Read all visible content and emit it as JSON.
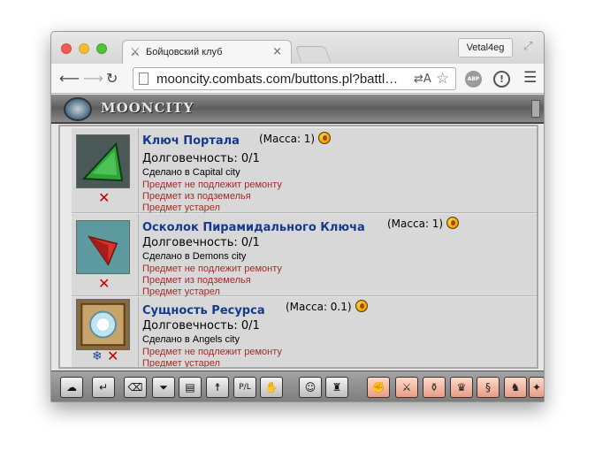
{
  "browser": {
    "tab_title": "Бойцовский клуб",
    "tab_close": "×",
    "profile_name": "Vetal4eg",
    "url": "mooncity.combats.com/buttons.pl?battl…",
    "translate_glyph": "⇄A",
    "abp_label": "ABP",
    "ext_label": "!"
  },
  "banner": {
    "title": "MOONCITY"
  },
  "items": [
    {
      "name": "Ключ Портала",
      "weight": "(Масса: 1)",
      "durability": "Долговечность: 0/1",
      "made_in": "Сделано в Capital city",
      "notes": [
        "Предмет не подлежит ремонту",
        "Предмет из подземелья",
        "Предмет устарел"
      ]
    },
    {
      "name": "Осколок Пирамидального Ключа",
      "weight": "(Масса: 1)",
      "durability": "Долговечность: 0/1",
      "made_in": "Сделано в Demons city",
      "notes": [
        "Предмет не подлежит ремонту",
        "Предмет из подземелья",
        "Предмет устарел"
      ]
    },
    {
      "name": "Сущность Ресурса",
      "weight": "(Масса: 0.1)",
      "durability": "Долговечность: 0/1",
      "made_in": "Сделано в Angels city",
      "notes": [
        "Предмет не подлежит ремонту",
        "Предмет устарел"
      ]
    }
  ],
  "icons": {
    "remove": "✕",
    "snowflake": "❄"
  },
  "bottom_bar": [
    {
      "name": "chat-icon",
      "glyph": "☁",
      "style": "grey"
    },
    {
      "name": "enter-icon",
      "glyph": "↵",
      "style": "grey"
    },
    {
      "name": "eraser-icon",
      "glyph": "⌫",
      "style": "grey"
    },
    {
      "name": "filter-icon",
      "glyph": "⏷",
      "style": "grey"
    },
    {
      "name": "book-icon",
      "glyph": "▤",
      "style": "grey"
    },
    {
      "name": "runner-icon",
      "glyph": "☨",
      "style": "grey"
    },
    {
      "name": "pl-icon",
      "glyph": "P/L",
      "style": "grey"
    },
    {
      "name": "hands-icon",
      "glyph": "✋",
      "style": "grey"
    },
    {
      "name": "smiley-icon",
      "glyph": "☺",
      "style": "grey"
    },
    {
      "name": "helmet-icon",
      "glyph": "♜",
      "style": "grey"
    },
    {
      "name": "fist-icon",
      "glyph": "✊",
      "style": "pink"
    },
    {
      "name": "sword-icon",
      "glyph": "⚔",
      "style": "pink"
    },
    {
      "name": "potion-icon",
      "glyph": "⚱",
      "style": "pink"
    },
    {
      "name": "crown-icon",
      "glyph": "♛",
      "style": "pink"
    },
    {
      "name": "scroll-icon",
      "glyph": "§",
      "style": "pink"
    },
    {
      "name": "knight-icon",
      "glyph": "♞",
      "style": "pink"
    },
    {
      "name": "compass-icon",
      "glyph": "✦",
      "style": "pink"
    }
  ]
}
